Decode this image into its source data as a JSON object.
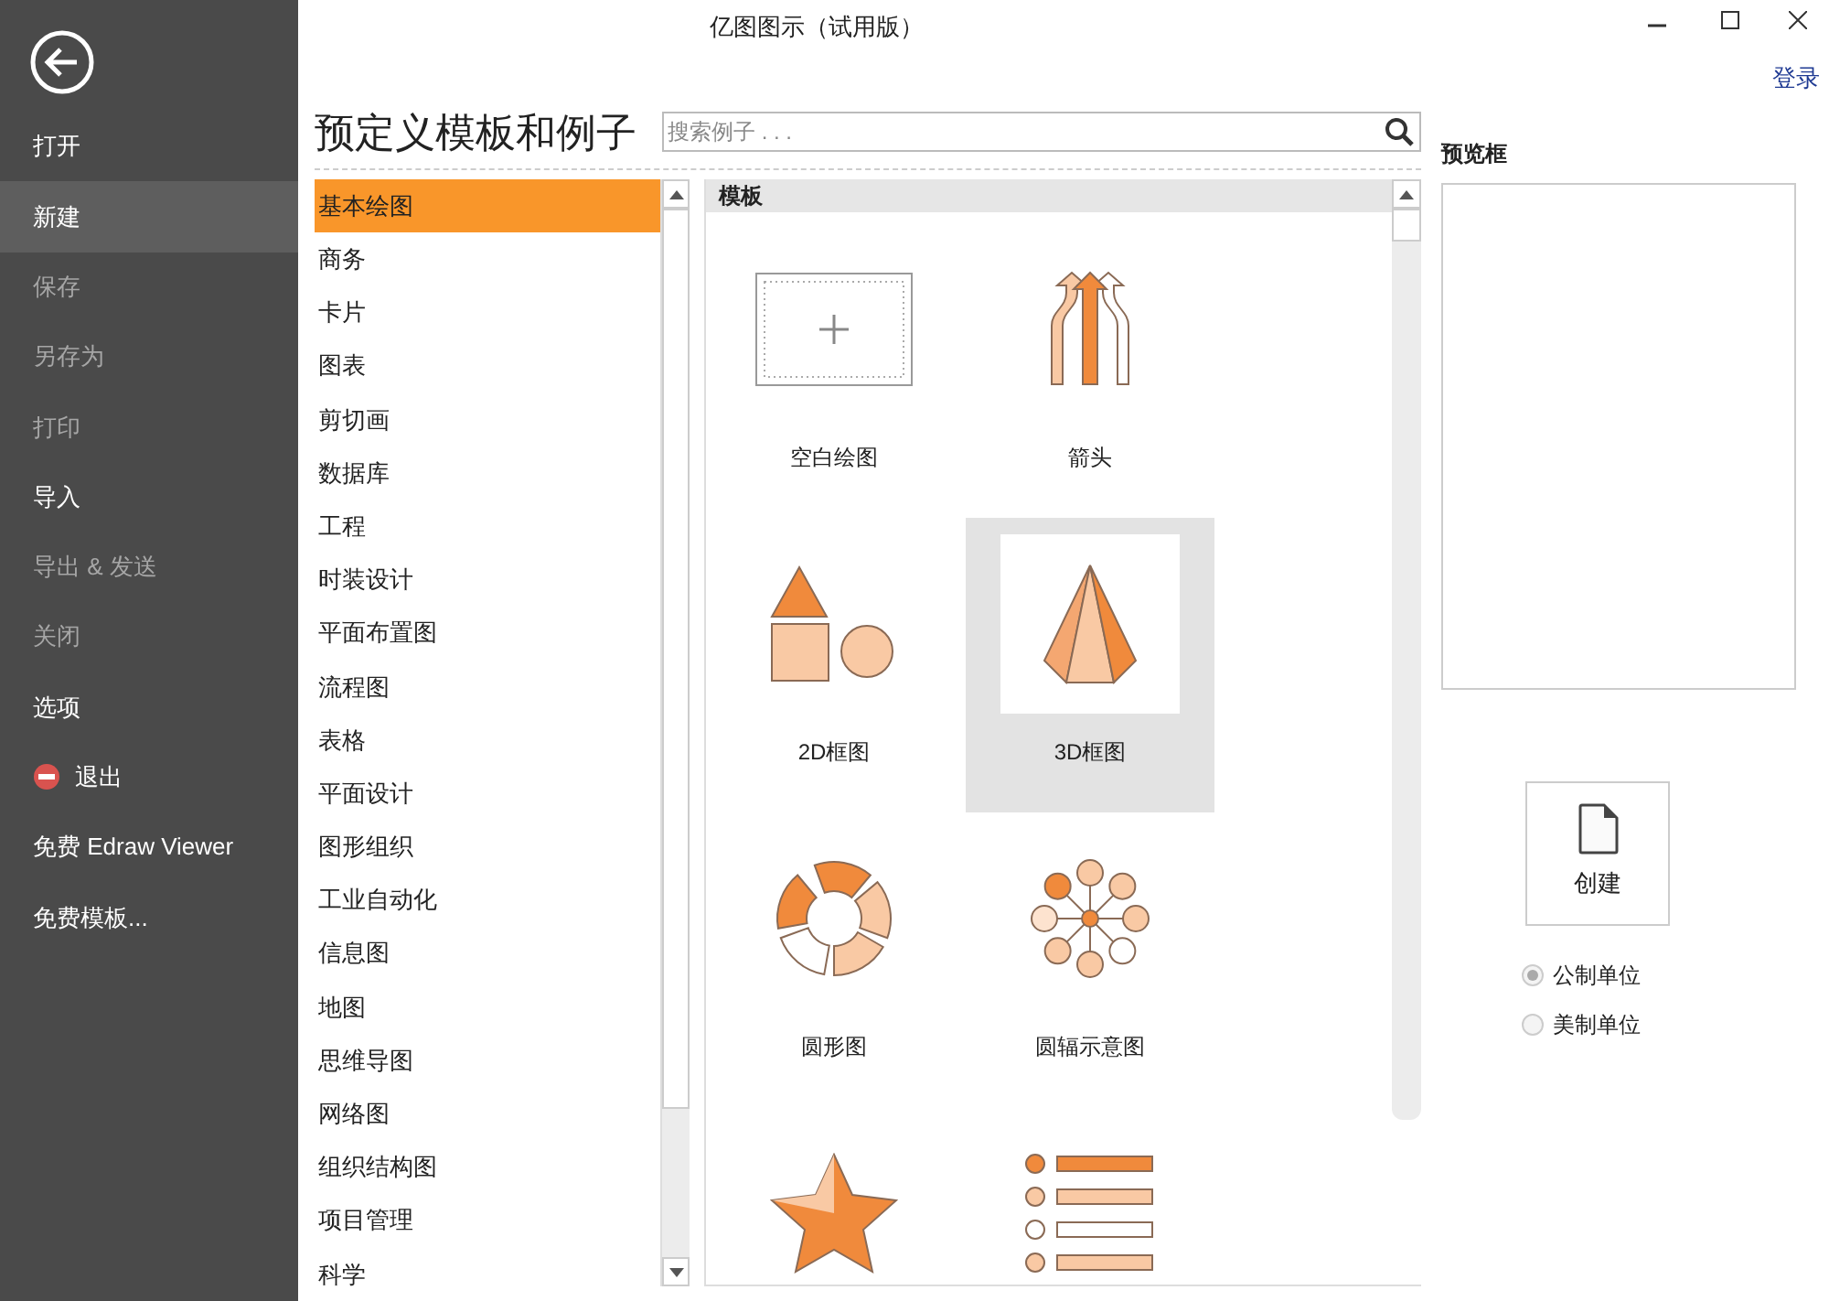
{
  "window": {
    "title": "亿图图示（试用版）"
  },
  "account_link": "登录",
  "sidebar": {
    "items": [
      {
        "kind": "text",
        "label": "打开",
        "selected": false,
        "disabled": false
      },
      {
        "kind": "text",
        "label": "新建",
        "selected": true,
        "disabled": false
      },
      {
        "kind": "text",
        "label": "保存",
        "selected": false,
        "disabled": true
      },
      {
        "kind": "text",
        "label": "另存为",
        "selected": false,
        "disabled": true
      },
      {
        "kind": "text",
        "label": "打印",
        "selected": false,
        "disabled": true
      },
      {
        "kind": "text",
        "label": "导入",
        "selected": false,
        "disabled": false
      },
      {
        "kind": "text",
        "label": "导出 & 发送",
        "selected": false,
        "disabled": true
      },
      {
        "kind": "text",
        "label": "关闭",
        "selected": false,
        "disabled": true
      },
      {
        "kind": "text",
        "label": "选项",
        "selected": false,
        "disabled": false
      },
      {
        "kind": "exit",
        "label": "退出",
        "selected": false,
        "disabled": false
      },
      {
        "kind": "text",
        "label": "免费 Edraw Viewer",
        "selected": false,
        "disabled": false
      },
      {
        "kind": "text",
        "label": "免费模板...",
        "selected": false,
        "disabled": false
      }
    ]
  },
  "heading": "预定义模板和例子",
  "search": {
    "placeholder": "搜索例子 . . ."
  },
  "categories": [
    {
      "label": "基本绘图",
      "selected": true
    },
    {
      "label": "商务",
      "selected": false
    },
    {
      "label": "卡片",
      "selected": false
    },
    {
      "label": "图表",
      "selected": false
    },
    {
      "label": "剪切画",
      "selected": false
    },
    {
      "label": "数据库",
      "selected": false
    },
    {
      "label": "工程",
      "selected": false
    },
    {
      "label": "时装设计",
      "selected": false
    },
    {
      "label": "平面布置图",
      "selected": false
    },
    {
      "label": "流程图",
      "selected": false
    },
    {
      "label": "表格",
      "selected": false
    },
    {
      "label": "平面设计",
      "selected": false
    },
    {
      "label": "图形组织",
      "selected": false
    },
    {
      "label": "工业自动化",
      "selected": false
    },
    {
      "label": "信息图",
      "selected": false
    },
    {
      "label": "地图",
      "selected": false
    },
    {
      "label": "思维导图",
      "selected": false
    },
    {
      "label": "网络图",
      "selected": false
    },
    {
      "label": "组织结构图",
      "selected": false
    },
    {
      "label": "项目管理",
      "selected": false
    },
    {
      "label": "科学",
      "selected": false
    }
  ],
  "templates": {
    "header": "模板",
    "items": [
      {
        "kind": "blank",
        "label": "空白绘图",
        "selected": false
      },
      {
        "kind": "arrows",
        "label": "箭头",
        "selected": false
      },
      {
        "kind": "shapes2d",
        "label": "2D框图",
        "selected": false
      },
      {
        "kind": "pyramid",
        "label": "3D框图",
        "selected": true
      },
      {
        "kind": "ring",
        "label": "圆形图",
        "selected": false
      },
      {
        "kind": "radial",
        "label": "圆辐示意图",
        "selected": false
      },
      {
        "kind": "star",
        "selected": false
      },
      {
        "kind": "list",
        "selected": false
      }
    ]
  },
  "preview": {
    "label": "预览框"
  },
  "create_button": "创建",
  "units": [
    {
      "label": "公制单位",
      "selected": true
    },
    {
      "label": "美制单位",
      "selected": false
    }
  ]
}
